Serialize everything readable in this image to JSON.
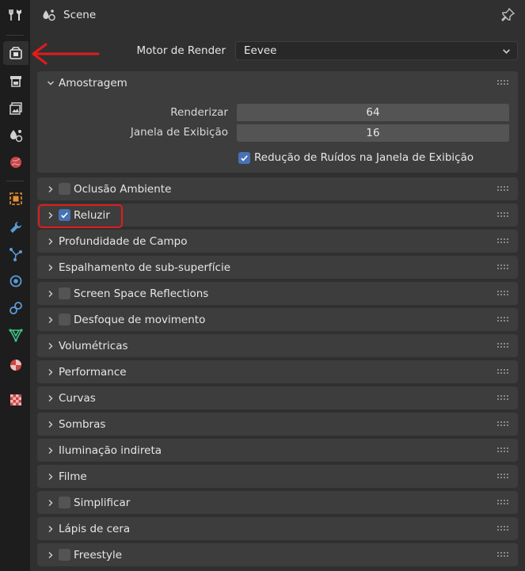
{
  "header": {
    "title": "Scene"
  },
  "sidebar": {
    "tabs": [
      {
        "name": "tool-tab",
        "icon": "tool-icon"
      },
      {
        "name": "render-tab",
        "icon": "render-icon",
        "active": true
      },
      {
        "name": "output-tab",
        "icon": "output-icon"
      },
      {
        "name": "view-layer-tab",
        "icon": "view-layer-icon"
      },
      {
        "name": "scene-tab",
        "icon": "scene-icon"
      },
      {
        "name": "world-tab",
        "icon": "world-icon"
      },
      {
        "name": "object-tab",
        "icon": "object-icon"
      },
      {
        "name": "modifiers-tab",
        "icon": "wrench-icon"
      },
      {
        "name": "particles-tab",
        "icon": "particles-icon"
      },
      {
        "name": "physics-tab",
        "icon": "physics-icon"
      },
      {
        "name": "constraints-tab",
        "icon": "constraints-icon"
      },
      {
        "name": "data-tab",
        "icon": "mesh-data-icon"
      },
      {
        "name": "material-tab",
        "icon": "material-icon"
      },
      {
        "name": "texture-tab",
        "icon": "texture-icon"
      }
    ]
  },
  "engine": {
    "label": "Motor de Render",
    "value": "Eevee"
  },
  "sampling": {
    "title": "Amostragem",
    "render_label": "Renderizar",
    "render_value": "64",
    "viewport_label": "Janela de Exibição",
    "viewport_value": "16",
    "denoise_label": "Redução de Ruídos na Janela de Exibição",
    "denoise_checked": true
  },
  "panels": [
    {
      "title": "Oclusão Ambiente",
      "checkbox": true,
      "checked": false
    },
    {
      "title": "Reluzir",
      "checkbox": true,
      "checked": true
    },
    {
      "title": "Profundidade de Campo",
      "checkbox": false
    },
    {
      "title": "Espalhamento de sub-superfície",
      "checkbox": false
    },
    {
      "title": "Screen Space Reflections",
      "checkbox": true,
      "checked": false
    },
    {
      "title": "Desfoque de movimento",
      "checkbox": true,
      "checked": false
    },
    {
      "title": "Volumétricas",
      "checkbox": false
    },
    {
      "title": "Performance",
      "checkbox": false
    },
    {
      "title": "Curvas",
      "checkbox": false
    },
    {
      "title": "Sombras",
      "checkbox": false
    },
    {
      "title": "Iluminação indireta",
      "checkbox": false
    },
    {
      "title": "Filme",
      "checkbox": false
    },
    {
      "title": "Simplificar",
      "checkbox": true,
      "checked": false
    },
    {
      "title": "Lápis de cera",
      "checkbox": false
    },
    {
      "title": "Freestyle",
      "checkbox": true,
      "checked": false
    }
  ],
  "colors": {
    "accent": "#4772b3",
    "annotation": "#e31b1b"
  }
}
